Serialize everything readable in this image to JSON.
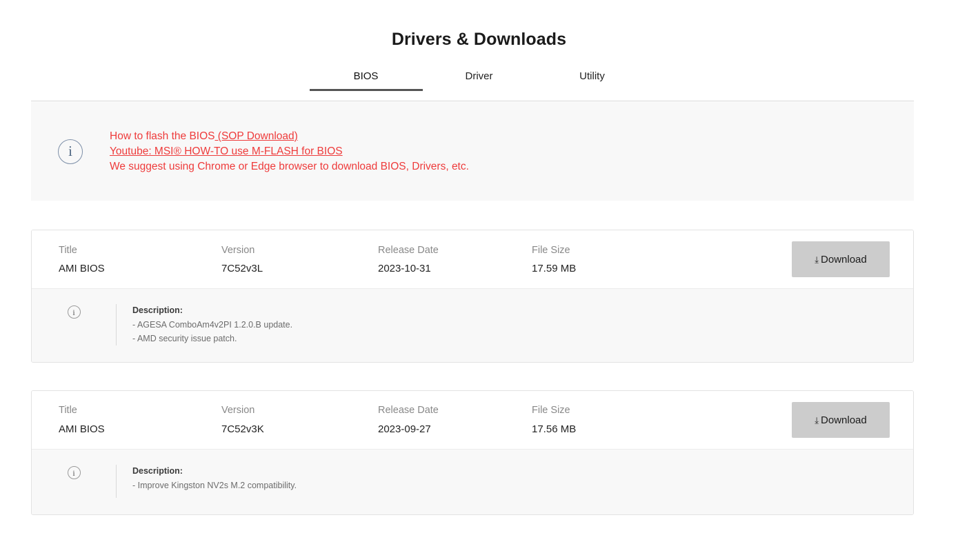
{
  "page": {
    "title": "Drivers & Downloads"
  },
  "tabs": [
    {
      "label": "BIOS",
      "active": true
    },
    {
      "label": "Driver",
      "active": false
    },
    {
      "label": "Utility",
      "active": false
    }
  ],
  "notice": {
    "icon": "info-icon",
    "icon_glyph": "i",
    "color": "#ee3b3b",
    "line1_plain": "How to flash the BIOS",
    "line1_link": " (SOP Download)",
    "line2_link": "Youtube: MSI® HOW-TO use M-FLASH for BIOS",
    "line3": "We suggest using Chrome or Edge browser to download BIOS, Drivers, etc."
  },
  "columns": {
    "title": "Title",
    "version": "Version",
    "release_date": "Release Date",
    "file_size": "File Size"
  },
  "download_button": {
    "label": "Download",
    "icon": "download-arrow-icon",
    "icon_glyph": "⤓",
    "background": "#cccccc"
  },
  "description_label": "Description:",
  "downloads": [
    {
      "title": "AMI BIOS",
      "version": "7C52v3L",
      "release_date": "2023-10-31",
      "file_size": "17.59 MB",
      "description": [
        "- AGESA ComboAm4v2PI 1.2.0.B update.",
        "- AMD security issue patch."
      ]
    },
    {
      "title": "AMI BIOS",
      "version": "7C52v3K",
      "release_date": "2023-09-27",
      "file_size": "17.56 MB",
      "description": [
        "- Improve Kingston NV2s M.2 compatibility."
      ]
    }
  ]
}
